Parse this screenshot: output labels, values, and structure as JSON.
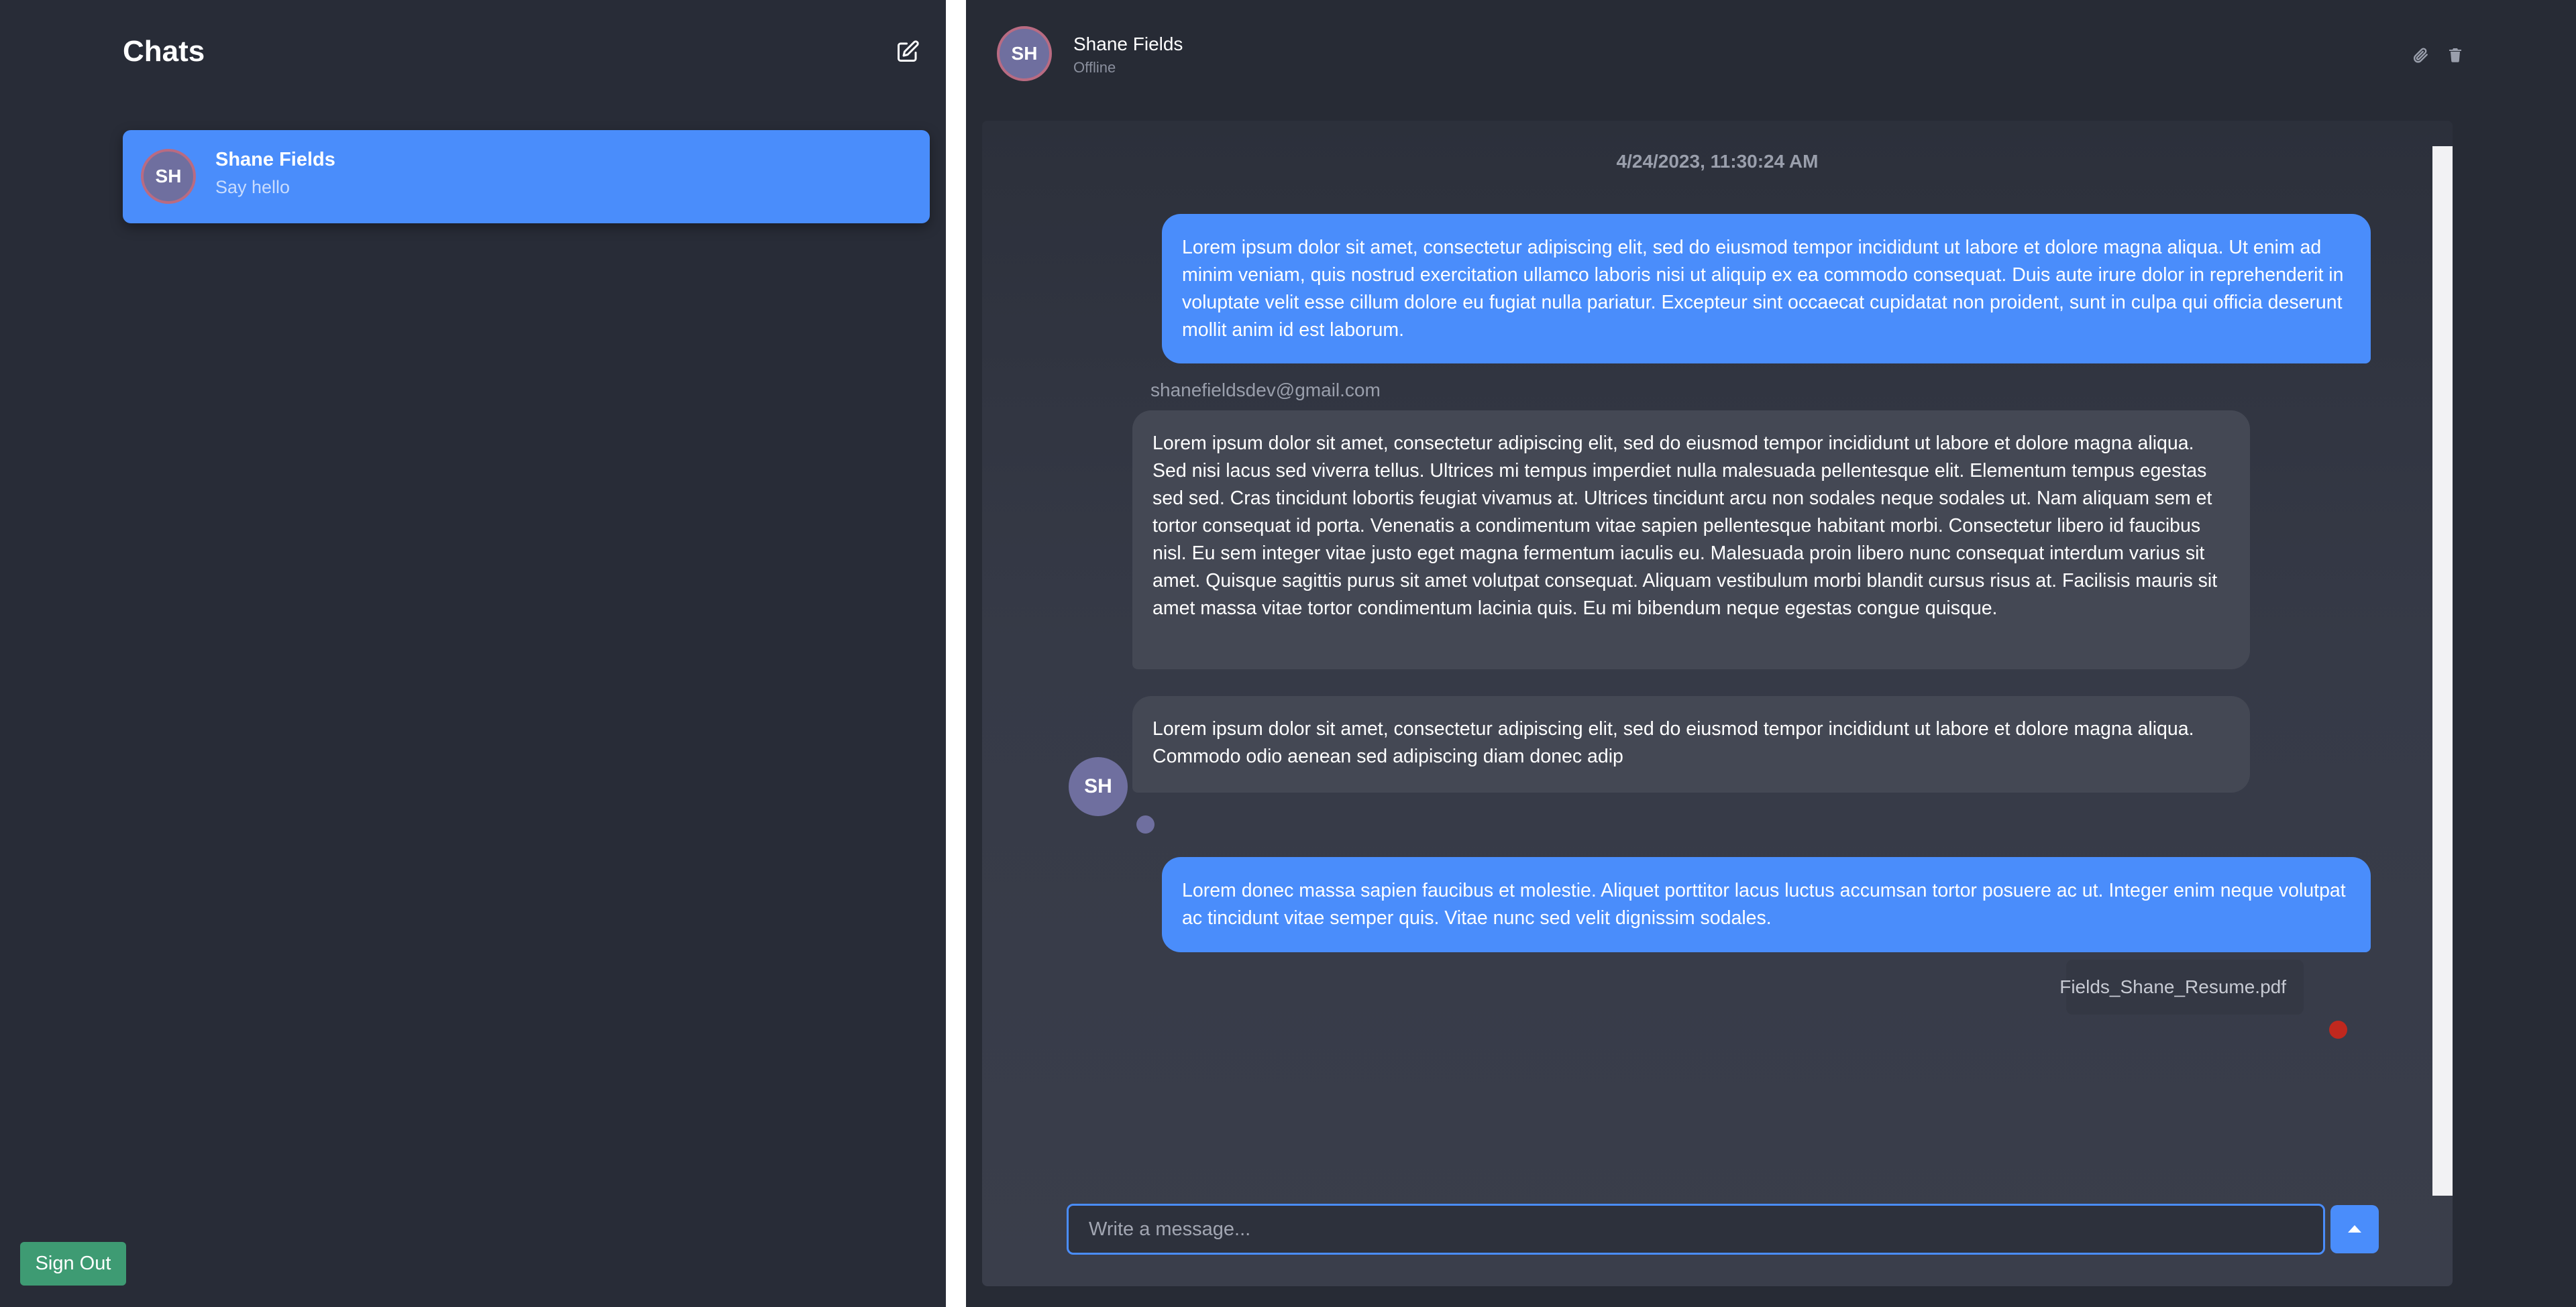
{
  "sidebar": {
    "title": "Chats",
    "compose_icon": "compose-icon",
    "chats": [
      {
        "initials": "SH",
        "name": "Shane Fields",
        "preview": "Say hello"
      }
    ],
    "signout_label": "Sign Out"
  },
  "header": {
    "initials": "SH",
    "name": "Shane Fields",
    "status": "Offline",
    "icons": [
      "paperclip-icon",
      "trash-icon"
    ]
  },
  "conversation": {
    "timestamp": "4/24/2023, 11:30:24 AM",
    "messages": [
      {
        "from": "me",
        "text": "Lorem ipsum dolor sit amet, consectetur adipiscing elit, sed do eiusmod tempor incididunt ut labore et dolore magna aliqua. Ut enim ad minim veniam, quis nostrud exercitation ullamco laboris nisi ut aliquip ex ea commodo consequat. Duis aute irure dolor in reprehenderit in voluptate velit esse cillum dolore eu fugiat nulla pariatur. Excepteur sint occaecat cupidatat non proident, sunt in culpa qui officia deserunt mollit anim id est laborum."
      },
      {
        "from": "them",
        "sender": "shanefieldsdev@gmail.com",
        "text": "Lorem ipsum dolor sit amet, consectetur adipiscing elit, sed do eiusmod tempor incididunt ut labore et dolore magna aliqua. Sed nisi lacus sed viverra tellus. Ultrices mi tempus imperdiet nulla malesuada pellentesque elit. Elementum tempus egestas sed sed. Cras tincidunt lobortis feugiat vivamus at. Ultrices tincidunt arcu non sodales neque sodales ut. Nam aliquam sem et tortor consequat id porta. Venenatis a condimentum vitae sapien pellentesque habitant morbi. Consectetur libero id faucibus nisl. Eu sem integer vitae justo eget magna fermentum iaculis eu. Malesuada proin libero nunc consequat interdum varius sit amet. Quisque sagittis purus sit amet volutpat consequat. Aliquam vestibulum morbi blandit cursus risus at. Facilisis mauris sit amet massa vitae tortor condimentum lacinia quis. Eu mi bibendum neque egestas congue quisque."
      },
      {
        "from": "them",
        "text": "Lorem ipsum dolor sit amet, consectetur adipiscing elit, sed do eiusmod tempor incididunt ut labore et dolore magna aliqua. Commodo odio aenean sed adipiscing diam donec adip",
        "avatar_initials": "SH"
      },
      {
        "from": "me",
        "text": "Lorem donec massa sapien faucibus et molestie. Aliquet porttitor lacus luctus accumsan tortor posuere ac ut. Integer enim neque volutpat ac tincidunt vitae semper quis. Vitae nunc sed velit dignissim sodales."
      }
    ],
    "attachment": {
      "icon": "file-icon",
      "filename": "Fields_Shane_Resume.pdf"
    }
  },
  "composer": {
    "placeholder": "Write a message...",
    "send_icon": "send-arrow-icon"
  },
  "colors": {
    "sidebar_bg": "#282c37",
    "accent": "#4a8dfb",
    "incoming_bubble": "#444854",
    "signout": "#3e9b73",
    "avatar": "#6f6f9f",
    "unread_dot": "#c0281e"
  }
}
